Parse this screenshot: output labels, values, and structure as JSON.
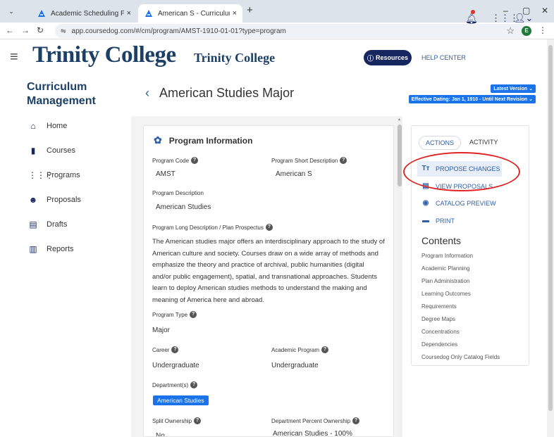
{
  "browser": {
    "tabs": [
      {
        "title": "Academic Scheduling Platform",
        "close": "×"
      },
      {
        "title": "American S - Curriculum | Cours",
        "close": "×"
      }
    ],
    "new_tab": "+",
    "window": {
      "minimize": "–",
      "maximize": "▢",
      "close": "✕"
    },
    "url_scheme_icon": "⇋",
    "url": "app.coursedog.com/#/cm/program/AMST-1910-01-01?type=program",
    "profile_initial": "E"
  },
  "header": {
    "logo": "Trinity College",
    "logo_sub": "Trinity College",
    "resources_label": "Resources",
    "help_center": "HELP CENTER"
  },
  "sidebar": {
    "title": "Curriculum Management",
    "items": [
      {
        "label": "Home",
        "icon": "home-icon"
      },
      {
        "label": "Courses",
        "icon": "book-icon"
      },
      {
        "label": "Programs",
        "icon": "grid-icon"
      },
      {
        "label": "Proposals",
        "icon": "people-icon"
      },
      {
        "label": "Drafts",
        "icon": "document-icon"
      },
      {
        "label": "Reports",
        "icon": "chart-icon"
      }
    ]
  },
  "page": {
    "title": "American Studies Major",
    "version": "Latest Version ⌄",
    "dating": "Effective Dating: Jan 1, 1910 - Until Next Revision ⌄"
  },
  "program_info": {
    "header": "Program Information",
    "program_code_label": "Program Code",
    "program_code": "AMST",
    "short_desc_label": "Program Short Description",
    "short_desc": "American S",
    "desc_label": "Program Description",
    "desc": "American Studies",
    "long_desc_label": "Program Long Description / Plan Prospectus",
    "long_desc": "The American studies major offers an interdisciplinary approach to the study of American culture and society. Courses draw on a wide array of methods and emphasize the theory and practice of archival, public humanities (digital and/or public engagement), spatial, and transnational approaches. Students learn to deploy American studies methods to understand the making and meaning of America here and abroad.",
    "type_label": "Program Type",
    "type": "Major",
    "career_label": "Career",
    "career": "Undergraduate",
    "academic_program_label": "Academic Program",
    "academic_program": "Undergraduate",
    "departments_label": "Department(s)",
    "department": "American Studies",
    "split_label": "Split Ownership",
    "split": "No",
    "dept_pct_label": "Department Percent Ownership",
    "dept_pct": "American Studies - 100%"
  },
  "actions": {
    "tab_actions": "ACTIONS",
    "tab_activity": "ACTIVITY",
    "items": [
      {
        "label": "PROPOSE CHANGES",
        "icon": "Tт"
      },
      {
        "label": "VIEW PROPOSALS",
        "icon": "▤"
      },
      {
        "label": "CATALOG PREVIEW",
        "icon": "◉"
      },
      {
        "label": "PRINT",
        "icon": "▬"
      }
    ],
    "contents_title": "Contents",
    "contents": [
      "Program Information",
      "Academic Planning",
      "Plan Administration",
      "Learning Outcomes",
      "Requirements",
      "Degree Maps",
      "Concentrations",
      "Dependencies",
      "Coursedog Only Catalog Fields"
    ]
  },
  "colors": {
    "brand": "#1c3f66",
    "accent": "#1a73e8",
    "link": "#2e5fa8",
    "annotation": "#e02424"
  }
}
